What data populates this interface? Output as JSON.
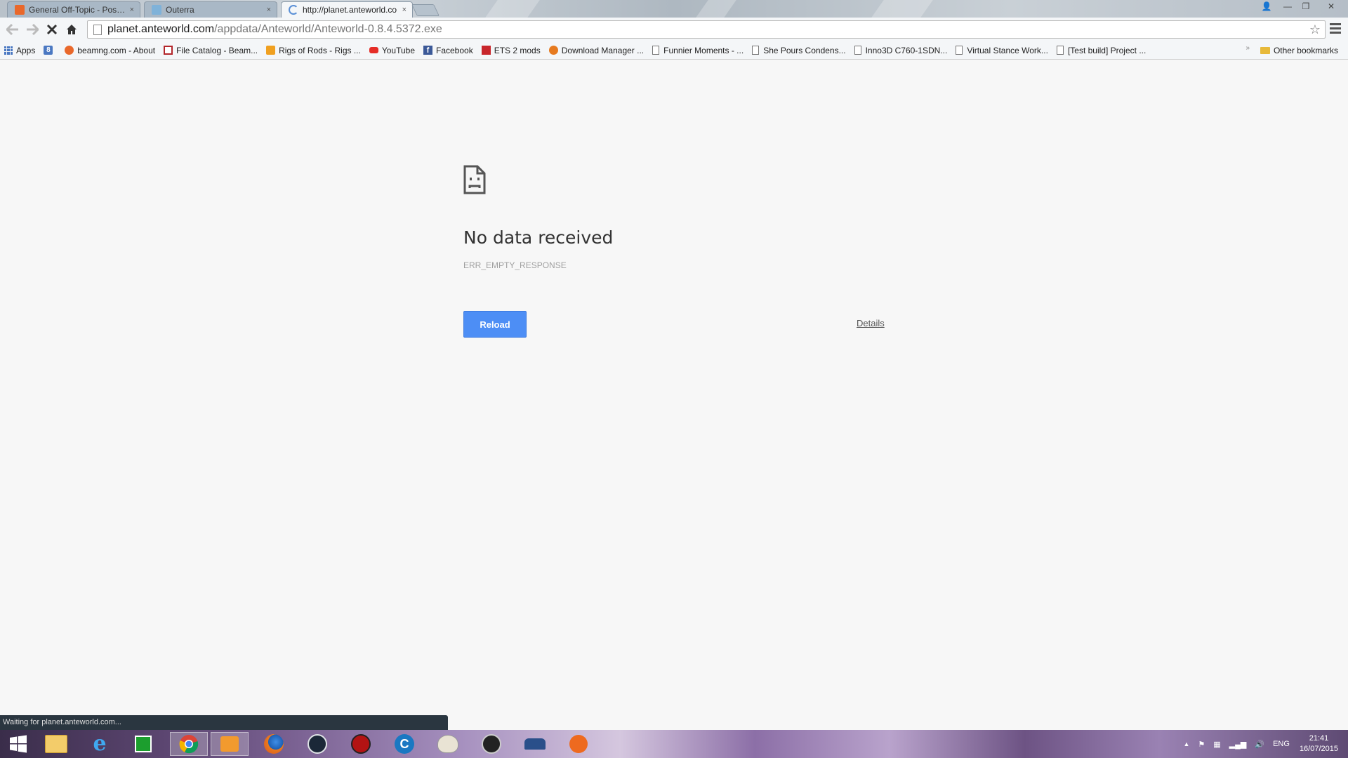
{
  "tabs": [
    {
      "title": "General Off-Topic - Post R",
      "close": "×"
    },
    {
      "title": "Outerra",
      "close": "×"
    },
    {
      "title": "http://planet.anteworld.co",
      "close": "×"
    }
  ],
  "titlebar": {
    "minimize": "—",
    "restore": "❐",
    "close": "✕",
    "profile": "👤"
  },
  "omnibox": {
    "host": "planet.anteworld.com",
    "path": "/appdata/Anteworld/Anteworld-0.8.4.5372.exe"
  },
  "bookmarks": [
    {
      "label": "Apps",
      "icon": "apps-grid-icon"
    },
    {
      "label": "",
      "icon": "google-plus-icon"
    },
    {
      "label": "beamng.com - About",
      "icon": "beamng-icon"
    },
    {
      "label": "File Catalog - Beam...",
      "icon": "file-catalog-icon"
    },
    {
      "label": "Rigs of Rods - Rigs ...",
      "icon": "rigs-of-rods-icon"
    },
    {
      "label": "YouTube",
      "icon": "youtube-icon"
    },
    {
      "label": "Facebook",
      "icon": "facebook-icon"
    },
    {
      "label": "ETS 2 mods",
      "icon": "ets2-icon"
    },
    {
      "label": "Download Manager ...",
      "icon": "download-manager-icon"
    },
    {
      "label": "Funnier Moments - ...",
      "icon": "page-icon"
    },
    {
      "label": "She Pours Condens...",
      "icon": "page-icon"
    },
    {
      "label": "Inno3D C760-1SDN...",
      "icon": "page-icon"
    },
    {
      "label": "Virtual Stance Work...",
      "icon": "page-icon"
    },
    {
      "label": "[Test build] Project ...",
      "icon": "page-icon"
    }
  ],
  "bookmarks_overflow": "»",
  "other_bookmarks": "Other bookmarks",
  "error": {
    "title": "No data received",
    "code": "ERR_EMPTY_RESPONSE",
    "reload_label": "Reload",
    "details_label": "Details"
  },
  "status_text": "Waiting for planet.anteworld.com...",
  "taskbar": {
    "apps": [
      "start-button",
      "file-explorer",
      "internet-explorer",
      "windows-store",
      "chrome",
      "media-player",
      "firefox",
      "steam",
      "app-red",
      "ccleaner",
      "paint",
      "obs",
      "game-car",
      "origin-app"
    ],
    "language": "ENG",
    "time": "21:41",
    "date": "16/07/2015",
    "tray_arrow": "▲"
  },
  "colors": {
    "accent": "#4d8ef5",
    "page_bg": "#f7f7f7"
  }
}
